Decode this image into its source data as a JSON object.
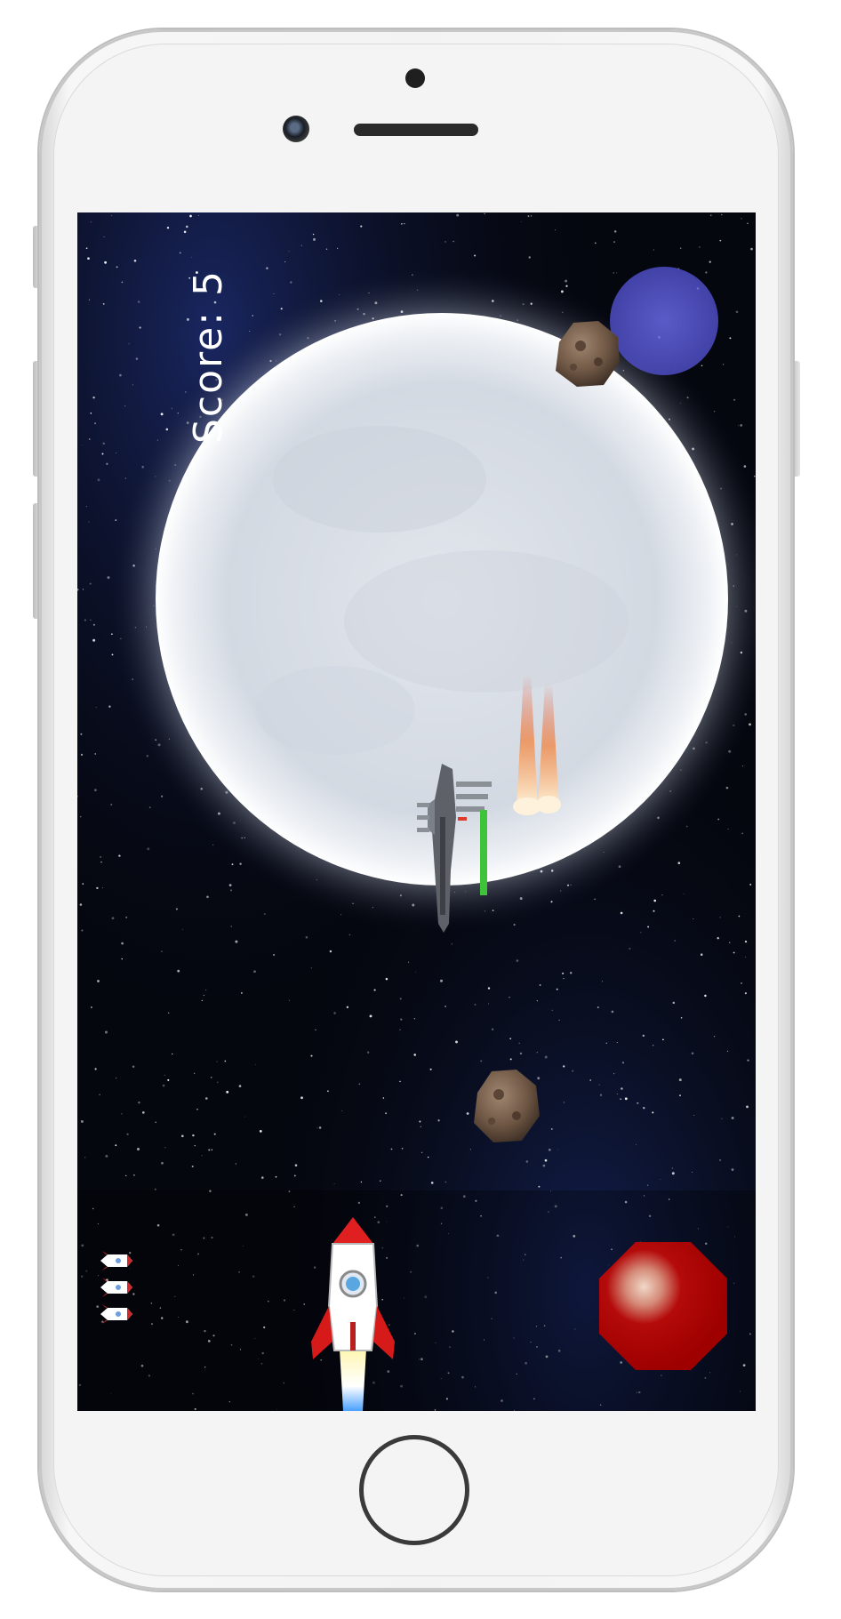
{
  "hud": {
    "score_label": "Score:",
    "score_value": "5",
    "lives": 3,
    "health_bar_color": "#3fc33a"
  },
  "scene": {
    "planet_color": "#e4e8ee",
    "fire_button_color": "#b30000",
    "orb_color": "#5b5bd6"
  },
  "icons": [
    "rocket-icon",
    "asteroid-icon",
    "enemy-ship-icon",
    "life-rocket-icon",
    "fire-button-icon"
  ]
}
